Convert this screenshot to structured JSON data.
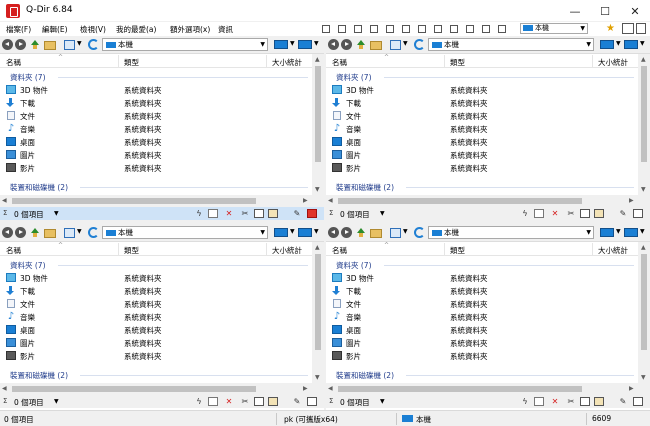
{
  "window": {
    "title": "Q-Dir 6.84",
    "controls": {
      "minimize": "—",
      "maximize": "☐",
      "close": "✕"
    }
  },
  "menu": {
    "file": "檔案(F)",
    "edit": "編輯(E)",
    "view": "檢視(V)",
    "favorites": "我的最愛(a)",
    "extras": "額外選項(x)",
    "info": "資訊"
  },
  "top_location": "本機",
  "columns": {
    "name": "名稱",
    "type": "類型",
    "size": "大小統計"
  },
  "groups": {
    "folders": "資料夾 (7)",
    "drives": "裝置和磁碟機 (2)"
  },
  "folder_type": "系統資料夾",
  "items": [
    {
      "name": "3D 物件",
      "icon": "cube-3d-icon"
    },
    {
      "name": "下載",
      "icon": "download-arrow-icon"
    },
    {
      "name": "文件",
      "icon": "document-icon"
    },
    {
      "name": "音樂",
      "icon": "music-note-icon"
    },
    {
      "name": "桌面",
      "icon": "desktop-icon"
    },
    {
      "name": "圖片",
      "icon": "picture-icon"
    },
    {
      "name": "影片",
      "icon": "video-icon"
    }
  ],
  "panes": [
    {
      "id": "pane-tl",
      "location": "本機",
      "count": "0 個項目",
      "active": true
    },
    {
      "id": "pane-tr",
      "location": "本機",
      "count": "0 個項目",
      "active": false
    },
    {
      "id": "pane-bl",
      "location": "本機",
      "count": "0 個項目",
      "active": false
    },
    {
      "id": "pane-br",
      "location": "本機",
      "count": "0 個項目",
      "active": false
    }
  ],
  "status": {
    "items": "0 個項目",
    "edition": "pk (可攜版x64)",
    "location": "本機",
    "number": "6609"
  },
  "colors": {
    "accent": "#1a7fd4",
    "group_text": "#1e3a8a",
    "active_status": "#cfe3f7",
    "delete_red": "#d51f1f"
  }
}
